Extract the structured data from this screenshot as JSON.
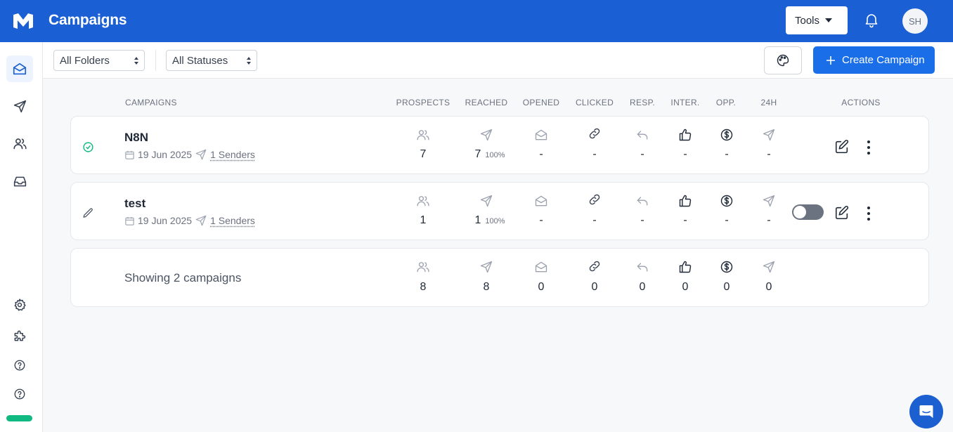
{
  "header": {
    "title": "Campaigns",
    "tools_label": "Tools",
    "avatar_initials": "SH"
  },
  "filters": {
    "folder": "All Folders",
    "status": "All Statuses",
    "create_label": "Create Campaign"
  },
  "columns": {
    "campaigns": "CAMPAIGNS",
    "prospects": "PROSPECTS",
    "reached": "REACHED",
    "opened": "OPENED",
    "clicked": "CLICKED",
    "resp": "RESP.",
    "inter": "INTER.",
    "opp": "OPP.",
    "h24": "24H",
    "actions": "ACTIONS"
  },
  "campaigns": [
    {
      "name": "N8N",
      "date": "19 Jun 2025",
      "senders": "1 Senders",
      "status": "active",
      "metrics": {
        "prospects": "7",
        "reached": "7",
        "reached_pct": "100%",
        "opened": "-",
        "clicked": "-",
        "resp": "-",
        "inter": "-",
        "opp": "-",
        "h24": "-"
      }
    },
    {
      "name": "test",
      "date": "19 Jun 2025",
      "senders": "1 Senders",
      "status": "draft",
      "enabled": false,
      "metrics": {
        "prospects": "1",
        "reached": "1",
        "reached_pct": "100%",
        "opened": "-",
        "clicked": "-",
        "resp": "-",
        "inter": "-",
        "opp": "-",
        "h24": "-"
      }
    }
  ],
  "summary": {
    "label": "Showing 2 campaigns",
    "totals": {
      "prospects": "8",
      "reached": "8",
      "opened": "0",
      "clicked": "0",
      "resp": "0",
      "inter": "0",
      "opp": "0",
      "h24": "0"
    }
  },
  "sidebar": {
    "items": [
      "campaigns-icon",
      "send-icon",
      "users-icon",
      "inbox-icon",
      "settings-icon",
      "integrations-icon",
      "help-icon",
      "support-icon"
    ]
  },
  "colors": {
    "brand": "#1a5fd4",
    "primary_button": "#1a6ee8",
    "success": "#10b981"
  }
}
